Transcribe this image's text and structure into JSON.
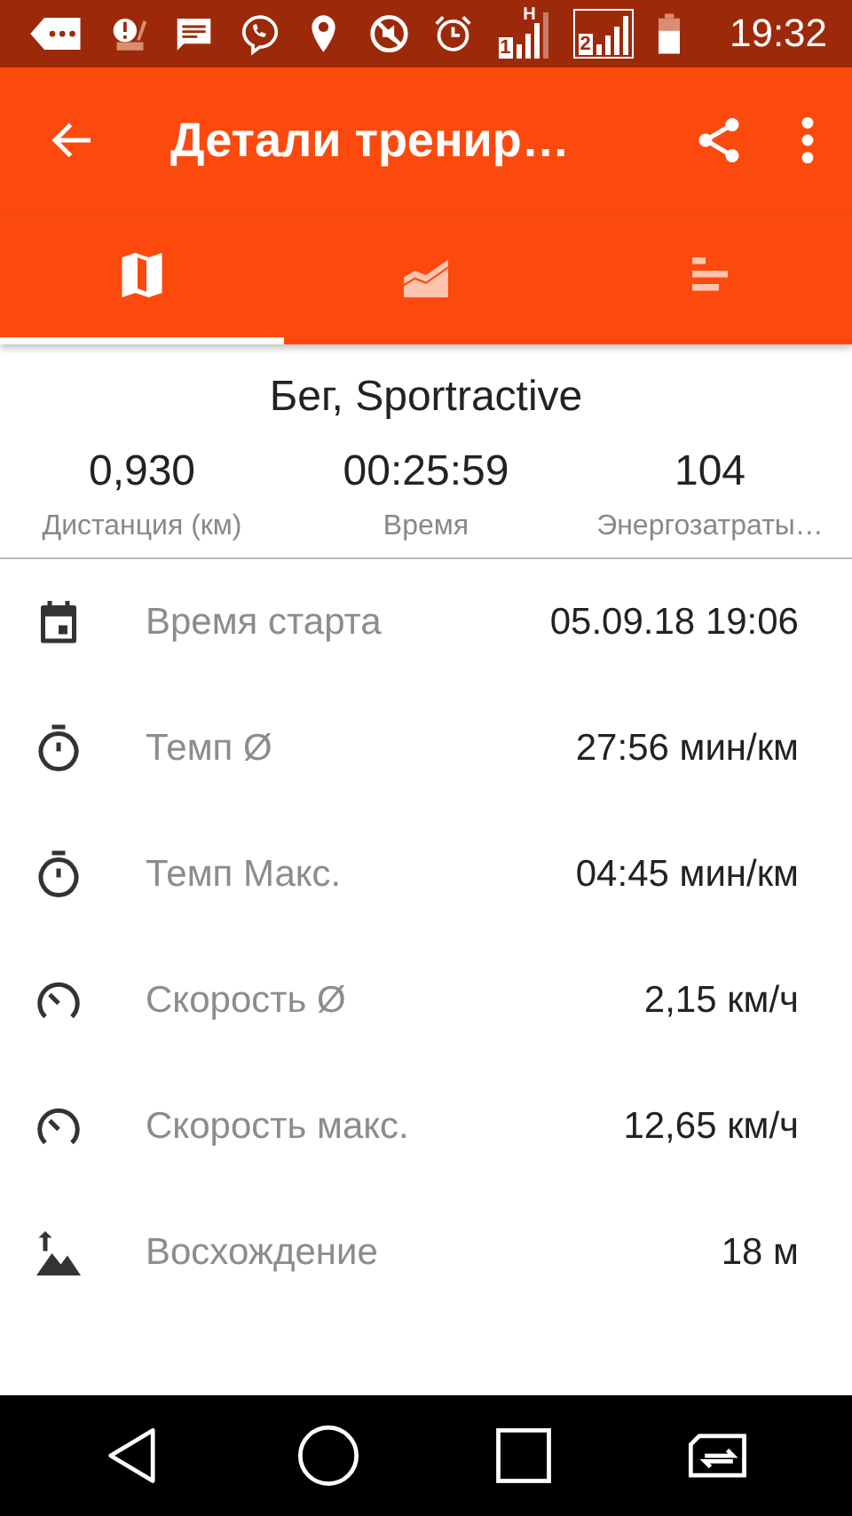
{
  "status_bar": {
    "sim1": "1",
    "network": "H",
    "sim2": "2",
    "time": "19:32"
  },
  "toolbar": {
    "title": "Детали тренир…"
  },
  "tabs": [
    {
      "kind": "map",
      "selected": true
    },
    {
      "kind": "chart",
      "selected": false
    },
    {
      "kind": "bars",
      "selected": false
    }
  ],
  "summary": {
    "title": "Бег, Sportractive",
    "stats": [
      {
        "value": "0,930",
        "label": "Дистанция (км)"
      },
      {
        "value": "00:25:59",
        "label": "Время"
      },
      {
        "value": "104",
        "label": "Энергозатраты…"
      }
    ]
  },
  "details": [
    {
      "kind": "calendar",
      "label": "Время старта",
      "value": "05.09.18 19:06"
    },
    {
      "kind": "stopwatch",
      "label": "Темп Ø",
      "value": "27:56 мин/км"
    },
    {
      "kind": "stopwatch",
      "label": "Темп Макс.",
      "value": "04:45 мин/км"
    },
    {
      "kind": "speedometer",
      "label": "Скорость Ø",
      "value": "2,15 км/ч"
    },
    {
      "kind": "speedometer",
      "label": "Скорость макс.",
      "value": "12,65 км/ч"
    },
    {
      "kind": "ascent",
      "label": "Восхождение",
      "value": "18 м"
    }
  ]
}
